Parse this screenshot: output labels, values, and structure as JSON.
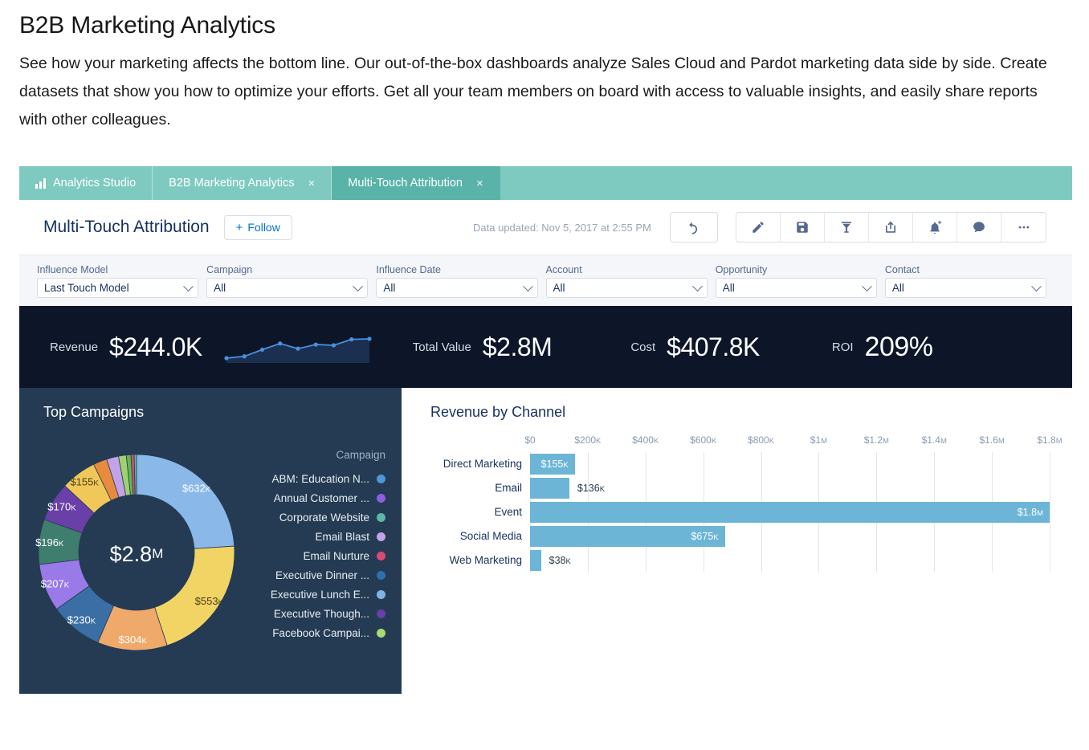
{
  "intro": {
    "heading": "B2B Marketing Analytics",
    "body": "See how your marketing affects the bottom line. Our out-of-the-box dashboards analyze Sales Cloud and Pardot marketing data side by side. Create datasets that show you how to optimize your efforts. Get all your team members on board with access to valuable insights, and easily share reports with other colleagues."
  },
  "tabs": [
    {
      "label": "Analytics Studio",
      "icon": "bar-chart-icon",
      "closable": false,
      "active": false
    },
    {
      "label": "B2B Marketing Analytics",
      "closable": true,
      "active": false,
      "close_glyph": "×"
    },
    {
      "label": "Multi-Touch Attribution",
      "closable": true,
      "active": true,
      "close_glyph": "×"
    }
  ],
  "header": {
    "title": "Multi-Touch Attribution",
    "follow_label": "Follow",
    "follow_plus": "+",
    "data_updated": "Data updated: Nov 5, 2017 at 2:55 PM",
    "tools": [
      {
        "name": "undo-icon",
        "group": "undo"
      },
      {
        "name": "edit-pencil-icon",
        "group": "actions"
      },
      {
        "name": "save-floppy-icon",
        "group": "actions"
      },
      {
        "name": "bookmark-clip-icon",
        "group": "actions"
      },
      {
        "name": "share-icon",
        "group": "actions"
      },
      {
        "name": "subscribe-bell-icon",
        "group": "actions"
      },
      {
        "name": "comment-icon",
        "group": "actions"
      },
      {
        "name": "more-options-icon",
        "group": "actions"
      }
    ]
  },
  "filters": [
    {
      "label": "Influence Model",
      "value": "Last Touch Model"
    },
    {
      "label": "Campaign",
      "value": "All"
    },
    {
      "label": "Influence Date",
      "value": "All"
    },
    {
      "label": "Account",
      "value": "All"
    },
    {
      "label": "Opportunity",
      "value": "All"
    },
    {
      "label": "Contact",
      "value": "All"
    }
  ],
  "kpis": [
    {
      "label": "Revenue",
      "value": "$244.0K"
    },
    {
      "label": "Total Value",
      "value": "$2.8M"
    },
    {
      "label": "Cost",
      "value": "$407.8K"
    },
    {
      "label": "ROI",
      "value": "209%"
    }
  ],
  "panels": {
    "top_campaigns_title": "Top Campaigns",
    "revenue_by_channel_title": "Revenue by Channel"
  },
  "donut": {
    "center_value": "$2.8",
    "center_unit": "M",
    "legend_title": "Campaign"
  },
  "chart_data": [
    {
      "type": "pie",
      "title": "Top Campaigns",
      "center_label": "$2.8M",
      "legend_title": "Campaign",
      "legend_position": "right",
      "labels": [
        "ABM: Education N...",
        "Annual Customer ...",
        "Corporate Website",
        "Email Blast",
        "Email Nurture",
        "Executive Dinner ...",
        "Executive Lunch E...",
        "Executive Though...",
        "Facebook Campai..."
      ],
      "legend_colors": [
        "#5296d5",
        "#8b5fe0",
        "#5bb8a4",
        "#c2a3e8",
        "#d94b72",
        "#2f6fad",
        "#82b4e3",
        "#6a3fa8",
        "#a9da74"
      ],
      "slices": [
        {
          "label": "$632",
          "unit": "K",
          "value": 632000,
          "color": "#8ab8e8",
          "label_color": "#ffffff"
        },
        {
          "label": "$553",
          "unit": "K",
          "value": 553000,
          "color": "#f2d濃",
          "label_color": "#4a3f17"
        },
        {
          "label": "$304",
          "unit": "K",
          "value": 304000,
          "color": "#efa96b",
          "label_color": "#ffffff"
        },
        {
          "label": "$230",
          "unit": "K",
          "value": 230000,
          "color": "#3a6ea5",
          "label_color": "#ffffff"
        },
        {
          "label": "$207",
          "unit": "K",
          "value": 207000,
          "color": "#9a7ae8",
          "label_color": "#ffffff"
        },
        {
          "label": "$196",
          "unit": "K",
          "value": 196000,
          "color": "#3f7d6e",
          "label_color": "#ffffff"
        },
        {
          "label": "$170",
          "unit": "K",
          "value": 170000,
          "color": "#6a3fa8",
          "label_color": "#ffffff"
        },
        {
          "label": "$155",
          "unit": "K",
          "value": 155000,
          "color": "#f0c85a",
          "label_color": "#4a3f17"
        }
      ],
      "small_slices": [
        {
          "color": "#e98b3f",
          "value": 60000
        },
        {
          "color": "#c2a3e8",
          "value": 52000
        },
        {
          "color": "#9fd16e",
          "value": 34000
        },
        {
          "color": "#62b84f",
          "value": 20000
        },
        {
          "color": "#d94b72",
          "value": 14000
        },
        {
          "color": "#5bb8a4",
          "value": 10000
        }
      ]
    },
    {
      "type": "bar",
      "orientation": "horizontal",
      "title": "Revenue by Channel",
      "xlabel": "",
      "ylabel": "",
      "xlim": [
        0,
        1800000
      ],
      "grid": true,
      "tick_labels": [
        "$0",
        "$200K",
        "$400K",
        "$600K",
        "$800K",
        "$1M",
        "$1.2M",
        "$1.4M",
        "$1.6M",
        "$1.8M"
      ],
      "tick_values": [
        0,
        200000,
        400000,
        600000,
        800000,
        1000000,
        1200000,
        1400000,
        1600000,
        1800000
      ],
      "bar_color": "#6cb5d6",
      "categories": [
        "Direct Marketing",
        "Email",
        "Event",
        "Social Media",
        "Web Marketing"
      ],
      "values": [
        155000,
        136000,
        1800000,
        675000,
        38000
      ],
      "value_labels": [
        {
          "text": "$155",
          "unit": "K",
          "inside": true
        },
        {
          "text": "$136",
          "unit": "K",
          "inside": false
        },
        {
          "text": "$1.8",
          "unit": "M",
          "inside": true
        },
        {
          "text": "$675",
          "unit": "K",
          "inside": true
        },
        {
          "text": "$38",
          "unit": "K",
          "inside": false
        }
      ]
    }
  ],
  "sparkline": {
    "points": [
      5,
      12,
      38,
      62,
      42,
      58,
      55,
      78,
      80
    ],
    "line_color": "#4b8fe0",
    "fill_color": "#1b3050"
  }
}
